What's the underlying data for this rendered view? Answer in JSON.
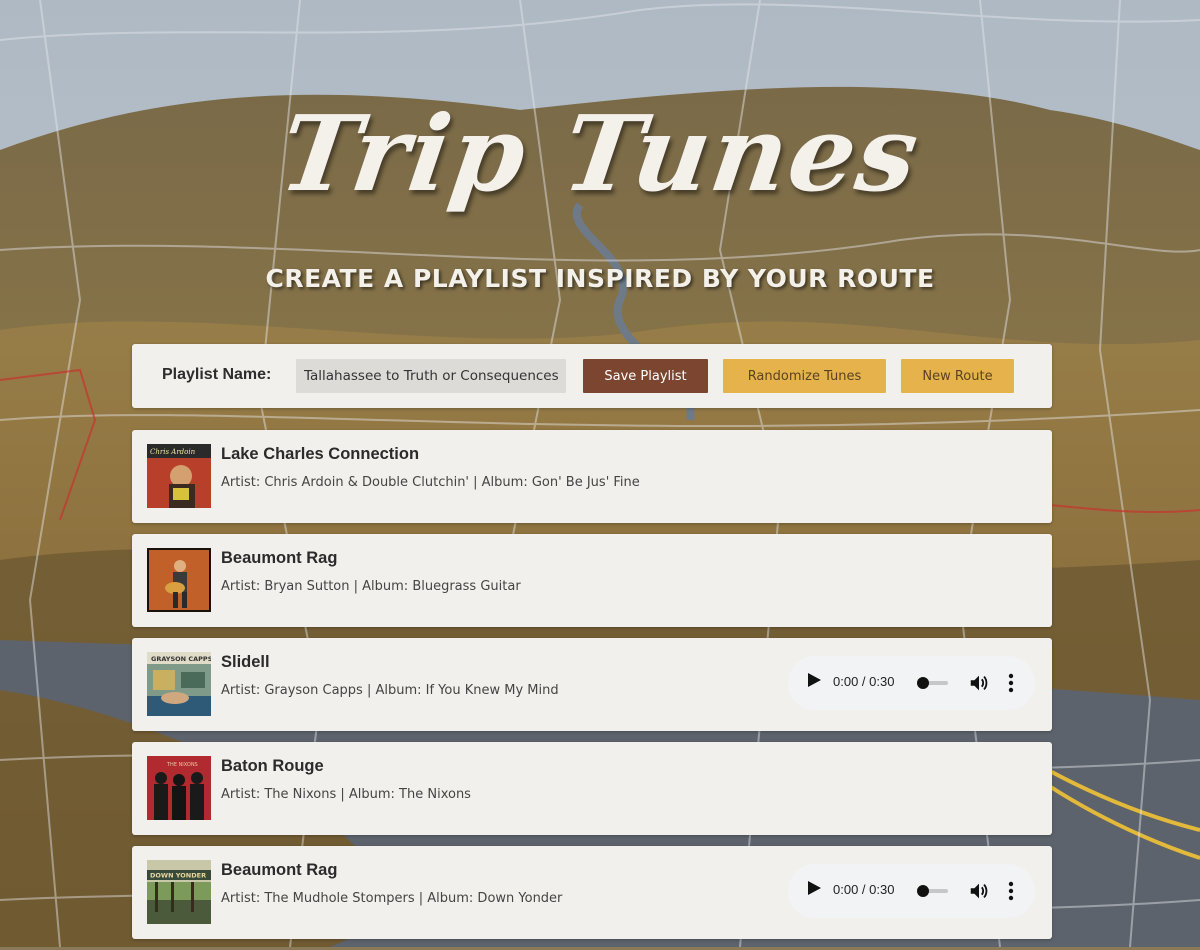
{
  "app": {
    "logo": "Trip Tunes",
    "tagline": "CREATE A PLAYLIST INSPIRED BY YOUR ROUTE"
  },
  "toolbar": {
    "playlist_label": "Playlist Name:",
    "playlist_value": "Tallahassee to Truth or Consequences",
    "save_label": "Save Playlist",
    "randomize_label": "Randomize Tunes",
    "new_route_label": "New Route"
  },
  "tracks": [
    {
      "title": "Lake Charles Connection",
      "meta": "Artist: Chris Ardoin & Double Clutchin' | Album: Gon' Be Jus' Fine",
      "cover_icon": "album-cover-gon-be-jus-fine",
      "cover_text": "Chris Ardoin",
      "has_player": false
    },
    {
      "title": "Beaumont Rag",
      "meta": "Artist: Bryan Sutton | Album: Bluegrass Guitar",
      "cover_icon": "album-cover-bluegrass-guitar",
      "has_player": false
    },
    {
      "title": "Slidell",
      "meta": "Artist: Grayson Capps | Album: If You Knew My Mind",
      "cover_icon": "album-cover-if-you-knew-my-mind",
      "cover_text": "GRAYSON CAPPS",
      "has_player": true,
      "player_time": "0:00 / 0:30",
      "progress": 0
    },
    {
      "title": "Baton Rouge",
      "meta": "Artist: The Nixons | Album: The Nixons",
      "cover_icon": "album-cover-the-nixons",
      "cover_text": "THE NIXONS",
      "has_player": false
    },
    {
      "title": "Beaumont Rag",
      "meta": "Artist: The Mudhole Stompers | Album: Down Yonder",
      "cover_icon": "album-cover-down-yonder",
      "cover_text": "DOWN YONDER",
      "has_player": true,
      "player_time": "0:00 / 0:30",
      "progress": 0
    }
  ],
  "colors": {
    "panel": "#f2f0ec",
    "save_button": "#7b4530",
    "accent_button": "#e5b24c"
  }
}
